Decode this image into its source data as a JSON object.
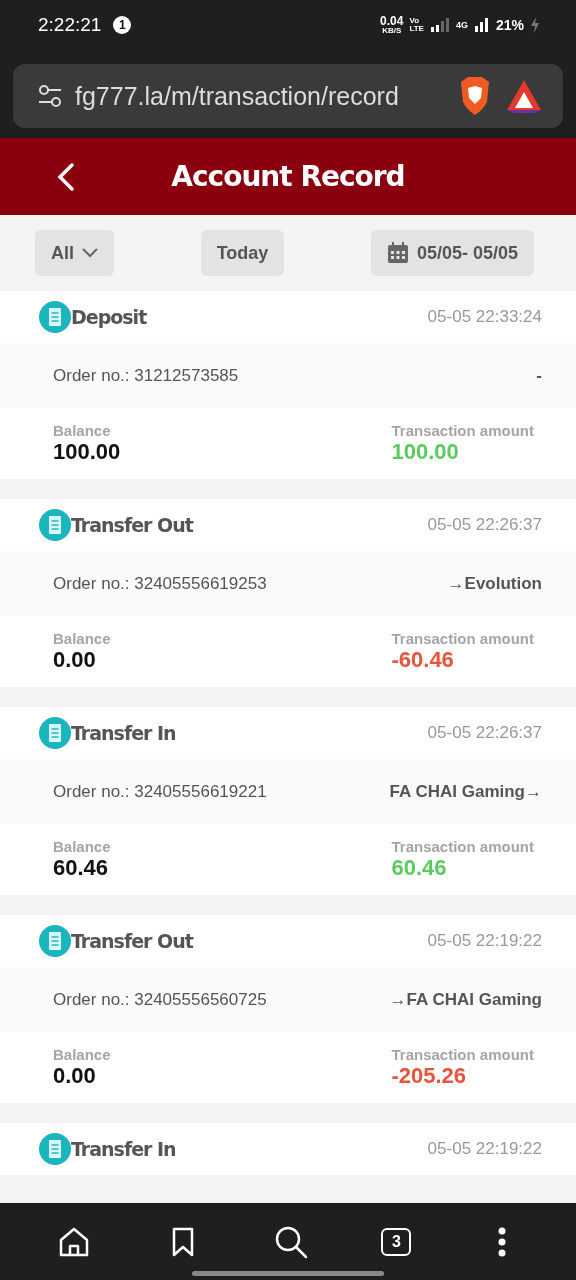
{
  "status_bar": {
    "time": "2:22:21",
    "notification_count": "1",
    "net_speed": "0.04",
    "net_unit": "KB/S",
    "volte": "Vo",
    "volte_sub": "LTE",
    "network": "4G",
    "battery": "21%"
  },
  "browser": {
    "url": "fg777.la/m/transaction/record",
    "tab_count": "3"
  },
  "header": {
    "title": "Account Record"
  },
  "filters": {
    "type": "All",
    "today": "Today",
    "date_range": "05/05- 05/05"
  },
  "records": [
    {
      "title": "Deposit",
      "time": "05-05 22:33:24",
      "order_label": "Order no.:",
      "order_no": "31212573585",
      "target": "-",
      "balance_label": "Balance",
      "balance": "100.00",
      "amount_label": "Transaction amount",
      "amount": "100.00",
      "kind": "credit"
    },
    {
      "title": "Transfer Out",
      "time": "05-05 22:26:37",
      "order_label": "Order no.:",
      "order_no": "32405556619253",
      "target": "→Evolution",
      "balance_label": "Balance",
      "balance": "0.00",
      "amount_label": "Transaction amount",
      "amount": "-60.46",
      "kind": "debit"
    },
    {
      "title": "Transfer In",
      "time": "05-05 22:26:37",
      "order_label": "Order no.:",
      "order_no": "32405556619221",
      "target": "FA CHAI Gaming→",
      "balance_label": "Balance",
      "balance": "60.46",
      "amount_label": "Transaction amount",
      "amount": "60.46",
      "kind": "credit"
    },
    {
      "title": "Transfer Out",
      "time": "05-05 22:19:22",
      "order_label": "Order no.:",
      "order_no": "32405556560725",
      "target": "→FA CHAI Gaming",
      "balance_label": "Balance",
      "balance": "0.00",
      "amount_label": "Transaction amount",
      "amount": "-205.26",
      "kind": "debit"
    },
    {
      "title": "Transfer In",
      "time": "05-05 22:19:22"
    }
  ]
}
